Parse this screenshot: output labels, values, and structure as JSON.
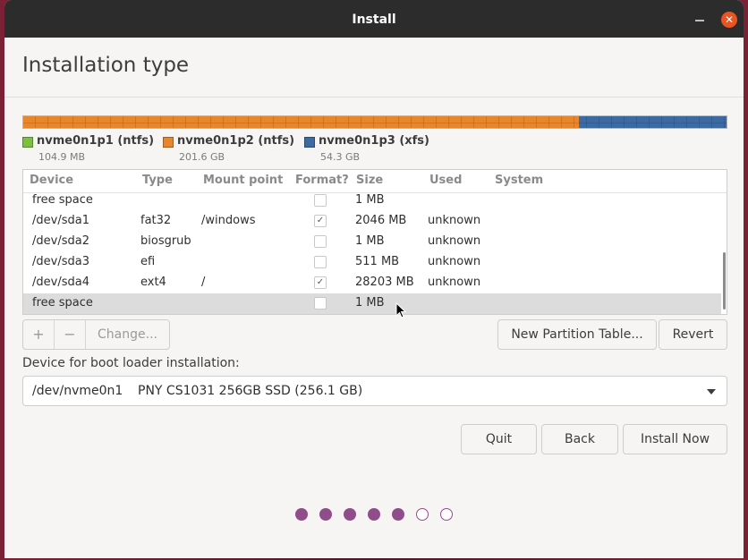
{
  "window": {
    "title": "Install"
  },
  "page": {
    "title": "Installation type"
  },
  "colors": {
    "titlebar": "#2c2c2c",
    "close_button": "#e95420",
    "ntfs_p1": "#7bc041",
    "ntfs_p2": "#e8862e",
    "xfs_p3": "#3e6aa2",
    "progress_dot": "#8f4e8b"
  },
  "legend": [
    {
      "name": "nvme0n1p1 (ntfs)",
      "size": "104.9 MB",
      "color": "#7bc041"
    },
    {
      "name": "nvme0n1p2 (ntfs)",
      "size": "201.6 GB",
      "color": "#e8862e"
    },
    {
      "name": "nvme0n1p3 (xfs)",
      "size": "54.3 GB",
      "color": "#3e6aa2"
    }
  ],
  "usage_bar": {
    "orange_fraction": 0.79,
    "blue_fraction": 0.21
  },
  "table": {
    "headers": {
      "device": "Device",
      "type": "Type",
      "mount": "Mount point",
      "format": "Format?",
      "size": "Size",
      "used": "Used",
      "system": "System"
    },
    "rows": [
      {
        "device": "free space",
        "type": "",
        "mount": "",
        "format": false,
        "size": "1 MB",
        "used": "",
        "system": ""
      },
      {
        "device": "/dev/sda1",
        "type": "fat32",
        "mount": "/windows",
        "format": true,
        "size": "2046 MB",
        "used": "unknown",
        "system": ""
      },
      {
        "device": "/dev/sda2",
        "type": "biosgrub",
        "mount": "",
        "format": false,
        "size": "1 MB",
        "used": "unknown",
        "system": ""
      },
      {
        "device": "/dev/sda3",
        "type": "efi",
        "mount": "",
        "format": false,
        "size": "511 MB",
        "used": "unknown",
        "system": ""
      },
      {
        "device": "/dev/sda4",
        "type": "ext4",
        "mount": "/",
        "format": true,
        "size": "28203 MB",
        "used": "unknown",
        "system": ""
      },
      {
        "device": "free space",
        "type": "",
        "mount": "",
        "format": false,
        "size": "1 MB",
        "used": "",
        "system": "",
        "selected": true
      }
    ]
  },
  "buttons": {
    "add": "+",
    "remove": "−",
    "change": "Change...",
    "new_partition_table": "New Partition Table...",
    "revert": "Revert",
    "quit": "Quit",
    "back": "Back",
    "install_now": "Install Now"
  },
  "bootloader": {
    "label": "Device for boot loader installation:",
    "device": "/dev/nvme0n1",
    "description": "PNY CS1031 256GB SSD (256.1 GB)"
  },
  "progress": {
    "total_steps": 7,
    "completed_steps": 5
  },
  "icons": {
    "close": "close-icon",
    "minimize": "minimize-icon",
    "dropdown": "chevron-down-icon",
    "check": "check-icon",
    "cursor": "mouse-pointer-icon"
  }
}
